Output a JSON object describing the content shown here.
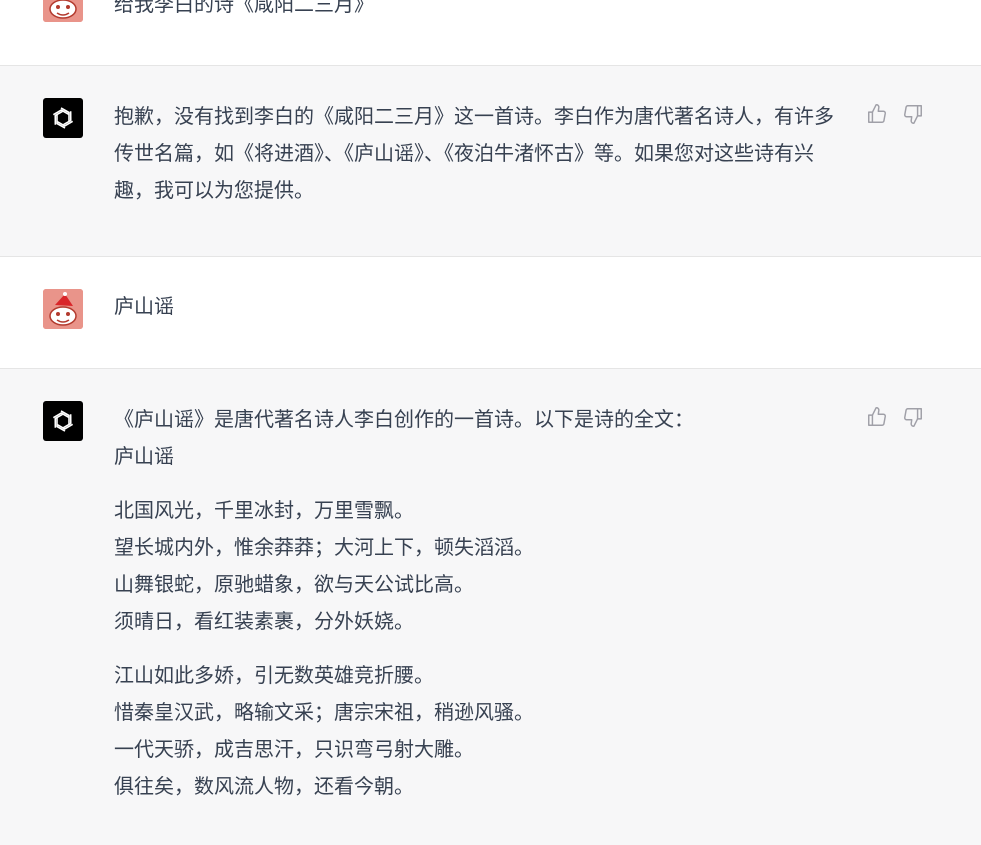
{
  "conversation": {
    "turns": [
      {
        "role": "user",
        "text": "给我李白的诗《咸阳二三月》"
      },
      {
        "role": "assistant",
        "text": "抱歉，没有找到李白的《咸阳二三月》这一首诗。李白作为唐代著名诗人，有许多传世名篇，如《将进酒》、《庐山谣》、《夜泊牛渚怀古》等。如果您对这些诗有兴趣，我可以为您提供。"
      },
      {
        "role": "user",
        "text": "庐山谣"
      },
      {
        "role": "assistant",
        "intro": "《庐山谣》是唐代著名诗人李白创作的一首诗。以下是诗的全文：",
        "poem_title": "庐山谣",
        "stanzas": [
          [
            "北国风光，千里冰封，万里雪飘。",
            "望长城内外，惟余莽莽；大河上下，顿失滔滔。",
            "山舞银蛇，原驰蜡象，欲与天公试比高。",
            "须晴日，看红装素裹，分外妖娆。"
          ],
          [
            "江山如此多娇，引无数英雄竞折腰。",
            "惜秦皇汉武，略输文采；唐宗宋祖，稍逊风骚。",
            "一代天骄，成吉思汗，只识弯弓射大雕。",
            "俱往矣，数风流人物，还看今朝。"
          ]
        ]
      }
    ]
  },
  "icons": {
    "assistant_avatar": "openai-logo-icon",
    "user_avatar": "user-avatar-icon",
    "thumbs_up": "thumbs-up-icon",
    "thumbs_down": "thumbs-down-icon"
  },
  "colors": {
    "assistant_bg": "#f7f7f8",
    "user_bg": "#ffffff",
    "user_avatar_bg": "#e9948a",
    "text": "#374151"
  }
}
